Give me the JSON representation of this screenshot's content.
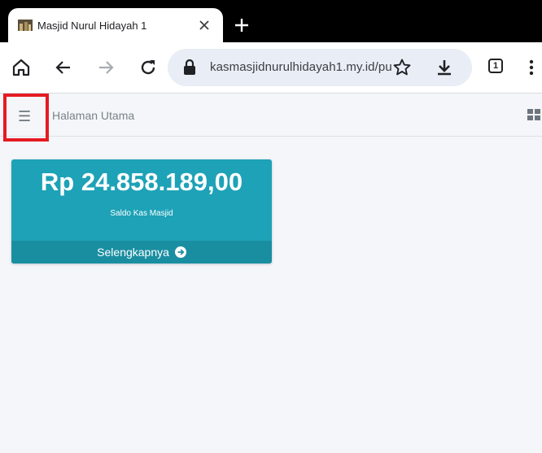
{
  "browser": {
    "tab": {
      "title": "Masjid Nurul Hidayah 1"
    },
    "address_bar": {
      "url": "kasmasjidnurulhidayah1.my.id/pu"
    },
    "tab_count": "1"
  },
  "navbar": {
    "home_link": "Halaman Utama"
  },
  "card": {
    "amount": "Rp 24.858.189,00",
    "subtitle": "Saldo Kas Masjid",
    "footer_label": "Selengkapnya",
    "color": "#1ea2b7"
  },
  "highlight": {
    "color": "#e51b23"
  }
}
